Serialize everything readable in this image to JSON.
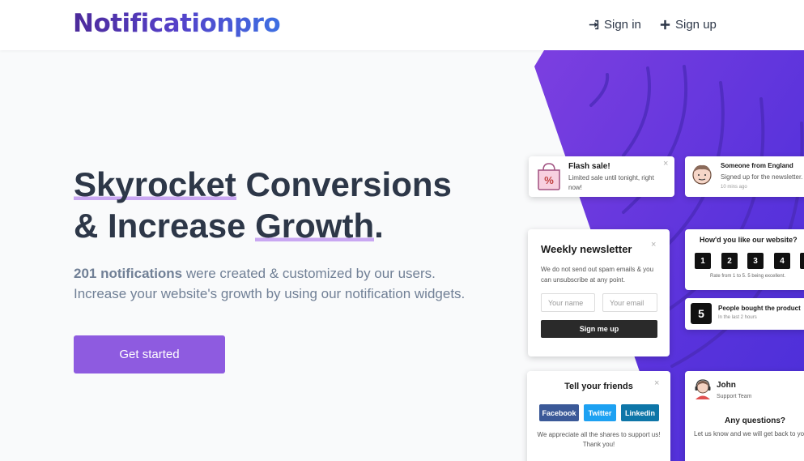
{
  "header": {
    "logo": "Notificationpro",
    "signin_label": "Sign in",
    "signup_label": "Sign up"
  },
  "hero": {
    "title_line1_highlight": "Skyrocket",
    "title_line1_rest": " Conversions",
    "title_line2_start": "& Increase ",
    "title_line2_highlight": "Growth",
    "title_line2_end": ".",
    "count_text": "201 notifications",
    "subtitle_rest": " were created & customized by our users.",
    "subtitle_line2": "Increase your website's growth by using our notification widgets.",
    "cta_label": "Get started"
  },
  "widgets": {
    "flash": {
      "title": "Flash sale!",
      "text": "Limited sale until tonight, right now!"
    },
    "someone": {
      "title": "Someone from England",
      "text": "Signed up for the newsletter.",
      "time": "10 mins ago"
    },
    "newsletter": {
      "title": "Weekly newsletter",
      "text": "We do not send out spam emails & you can unsubscribe at any point.",
      "name_placeholder": "Your name",
      "email_placeholder": "Your email",
      "button": "Sign me up"
    },
    "rating": {
      "title": "How'd you like our website?",
      "options": [
        "1",
        "2",
        "3",
        "4"
      ],
      "caption": "Rate from 1 to 5. 5 being excellent."
    },
    "bought": {
      "count": "5",
      "title": "People bought the product",
      "text": "In the last 2 hours"
    },
    "friends": {
      "title": "Tell your friends",
      "facebook": "Facebook",
      "twitter": "Twitter",
      "linkedin": "Linkedin",
      "text": "We appreciate all the shares to support us! Thank you!"
    },
    "support": {
      "name": "John",
      "team": "Support Team",
      "question": "Any questions?",
      "text": "Let us know and we will get back to you!"
    }
  },
  "colors": {
    "accent": "#8e5be0",
    "hero_gradient_start": "#7c3fe0",
    "hero_gradient_end": "#4a2fd8",
    "facebook": "#3b5998",
    "twitter": "#1da1f2",
    "linkedin": "#0e76a8"
  }
}
